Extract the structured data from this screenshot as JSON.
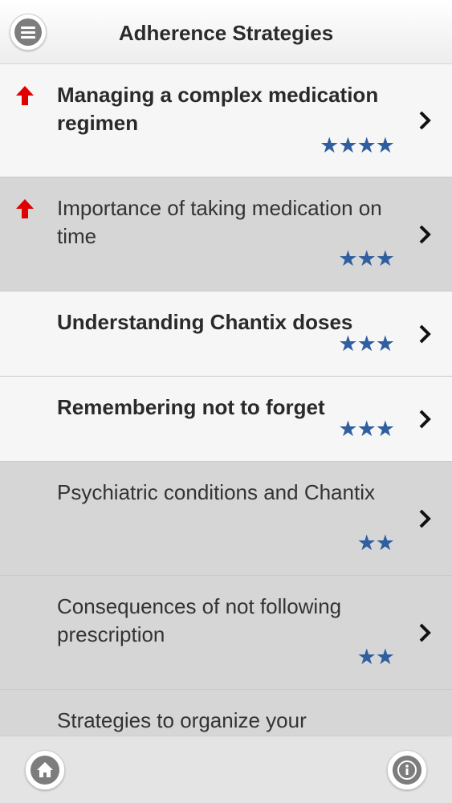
{
  "header": {
    "title": "Adherence Strategies",
    "menu_icon": "hamburger-menu-icon"
  },
  "colors": {
    "accent_star": "#2f5f9e",
    "priority_arrow": "#e00000"
  },
  "list": {
    "items": [
      {
        "label": "Managing a complex medication regimen",
        "stars": "★★★★",
        "rating": 4,
        "priority": true
      },
      {
        "label": "Importance of taking medication on time",
        "stars": "★★★",
        "rating": 3,
        "priority": true
      },
      {
        "label": "Understanding Chantix doses",
        "stars": "★★★",
        "rating": 3,
        "priority": false
      },
      {
        "label": "Remembering not to forget",
        "stars": "★★★",
        "rating": 3,
        "priority": false
      },
      {
        "label": "Psychiatric conditions and Chantix",
        "stars": "★★",
        "rating": 2,
        "priority": false
      },
      {
        "label": "Consequences of not following prescription",
        "stars": "★★",
        "rating": 2,
        "priority": false
      },
      {
        "label": "Strategies to organize your",
        "stars": "",
        "rating": null,
        "priority": false
      }
    ]
  },
  "footer": {
    "home_icon": "home-icon",
    "info_icon": "info-icon"
  }
}
